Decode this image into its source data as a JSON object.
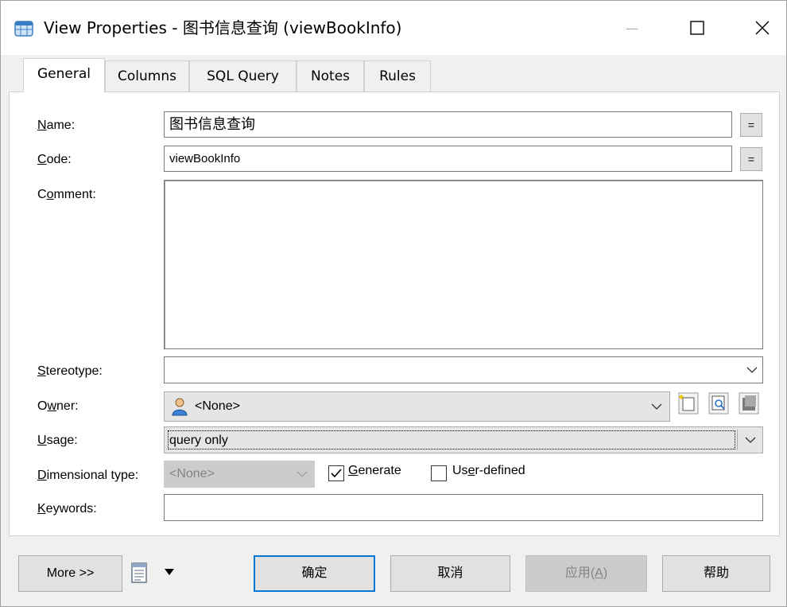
{
  "window": {
    "title": "View Properties - 图书信息查询 (viewBookInfo)",
    "minimize_glyph": "—",
    "close_glyph": "✕"
  },
  "tabs": [
    {
      "label": "General",
      "active": true
    },
    {
      "label": "Columns"
    },
    {
      "label": "SQL Query"
    },
    {
      "label": "Notes"
    },
    {
      "label": "Rules"
    }
  ],
  "fields": {
    "name": {
      "label_pre": "",
      "label_key": "N",
      "label_post": "ame:",
      "value": "图书信息查询",
      "eq": "="
    },
    "code": {
      "label_pre": "",
      "label_key": "C",
      "label_post": "ode:",
      "value": "viewBookInfo",
      "eq": "="
    },
    "comment": {
      "label_pre": "C",
      "label_key": "o",
      "label_post": "mment:",
      "value": ""
    },
    "stereotype": {
      "label_pre": "",
      "label_key": "S",
      "label_post": "tereotype:",
      "value": ""
    },
    "owner": {
      "label_pre": "O",
      "label_key": "w",
      "label_post": "ner:",
      "value": "<None>"
    },
    "usage": {
      "label_pre": "",
      "label_key": "U",
      "label_post": "sage:",
      "value": "query only"
    },
    "dimensional_type": {
      "label_pre": "",
      "label_key": "D",
      "label_post": "imensional type:",
      "value": "<None>",
      "disabled": true
    },
    "keywords": {
      "label_pre": "",
      "label_key": "K",
      "label_post": "eywords:",
      "value": ""
    }
  },
  "checkboxes": {
    "generate": {
      "label_pre": "",
      "label_key": "G",
      "label_post": "enerate",
      "checked": true
    },
    "user_defined": {
      "label_pre": "Us",
      "label_key": "e",
      "label_post": "r-defined",
      "checked": false
    }
  },
  "buttons": {
    "more": "More >>",
    "ok": "确定",
    "cancel": "取消",
    "apply_pre": "应用(",
    "apply_key": "A",
    "apply_post": ")",
    "help": "帮助"
  },
  "colors": {
    "accent": "#0078d7",
    "window_bg": "#f0f0f0",
    "disabled_text": "#838383"
  }
}
